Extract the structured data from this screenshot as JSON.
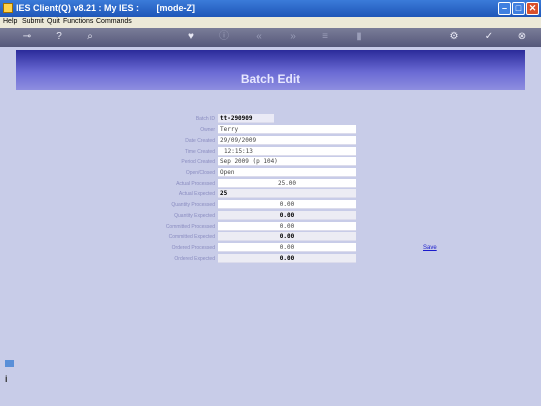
{
  "window": {
    "title": "IES Client(Q) v8.21 : My IES :       [mode-Z]"
  },
  "menu": [
    "Help",
    "Submit",
    "Quit",
    "Functions",
    "Commands"
  ],
  "toolbar": {
    "icons": [
      "key-icon",
      "help-icon",
      "search-icon",
      "heart-icon",
      "info-icon",
      "rewind-icon",
      "forward-icon",
      "list-icon",
      "trash-icon",
      "settings-icon",
      "check-icon",
      "close-icon"
    ]
  },
  "page": {
    "title": "Batch Edit",
    "save_label": "Save"
  },
  "form": {
    "rows": [
      {
        "label": "Batch ID",
        "value": "tt-290909"
      },
      {
        "label": "Owner",
        "value": "Terry"
      },
      {
        "label": "Date Created",
        "value": "29/09/2009"
      },
      {
        "label": "Time Created",
        "value": "12:15:13"
      },
      {
        "label": "Period Created",
        "value": "Sep 2009 (p 104)"
      },
      {
        "label": "Open/Closed",
        "value": "Open"
      },
      {
        "label": "Actual Processed",
        "value": "25.00"
      },
      {
        "label": "Actual Expected",
        "value": "25"
      },
      {
        "label": "Quantity Processed",
        "value": "0.00"
      },
      {
        "label": "Quantity Expected",
        "value": "0.00"
      },
      {
        "label": "Committed Processed",
        "value": "0.00"
      },
      {
        "label": "Committed Expected",
        "value": "0.00"
      },
      {
        "label": "Ordered Processed",
        "value": "0.00"
      },
      {
        "label": "Ordered Expected",
        "value": "0.00"
      }
    ]
  }
}
